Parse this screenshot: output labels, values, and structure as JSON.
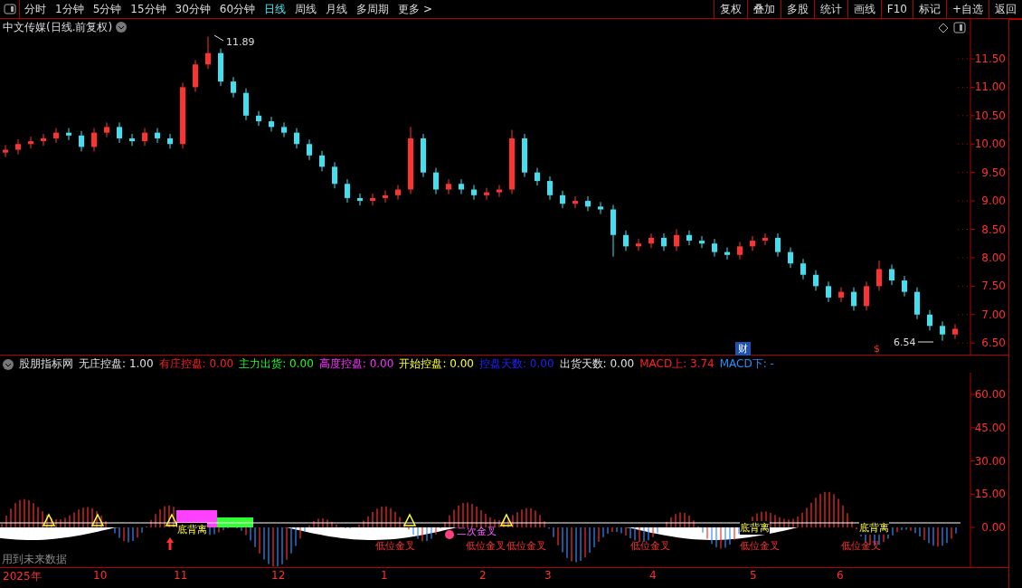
{
  "toolbar": {
    "periods": [
      {
        "label": "分时",
        "selected": false
      },
      {
        "label": "1分钟",
        "selected": false
      },
      {
        "label": "5分钟",
        "selected": false
      },
      {
        "label": "15分钟",
        "selected": false
      },
      {
        "label": "30分钟",
        "selected": false
      },
      {
        "label": "60分钟",
        "selected": false
      },
      {
        "label": "日线",
        "selected": true
      },
      {
        "label": "周线",
        "selected": false
      },
      {
        "label": "月线",
        "selected": false
      },
      {
        "label": "多周期",
        "selected": false
      },
      {
        "label": "更多 >",
        "selected": false
      }
    ],
    "buttons": [
      "复权",
      "叠加",
      "多股",
      "统计",
      "画线",
      "F10",
      "标记",
      "+自选",
      "返回"
    ]
  },
  "price_panel": {
    "title": "中文传媒(日线.前复权)",
    "high_label": "11.89",
    "low_label": "6.54",
    "finance_badge": "财",
    "dividend_mark": "$",
    "chart_data": {
      "type": "candlestick",
      "ylim": [
        6.28,
        12.2
      ],
      "yticks": [
        {
          "value": 11.5,
          "label": "11.50"
        },
        {
          "value": 11,
          "label": "11.00"
        },
        {
          "value": 10.5,
          "label": "10.50"
        },
        {
          "value": 10,
          "label": "10.00"
        },
        {
          "value": 9.5,
          "label": "9.50"
        },
        {
          "value": 9,
          "label": "9.00"
        },
        {
          "value": 8.5,
          "label": "8.50"
        },
        {
          "value": 8,
          "label": "8.00"
        },
        {
          "value": 7.5,
          "label": "7.50"
        },
        {
          "value": 7,
          "label": "7.00"
        },
        {
          "value": 6.5,
          "label": "6.50"
        }
      ],
      "categories": [
        null,
        null,
        null,
        null,
        null,
        null,
        null,
        null,
        null,
        null,
        null,
        null,
        null,
        null,
        null,
        null,
        null,
        null,
        null,
        null,
        null,
        null,
        null,
        null,
        null,
        null,
        null,
        null,
        null,
        null,
        null,
        null,
        null,
        null,
        null,
        null,
        null,
        null,
        null,
        null,
        null,
        null,
        null,
        null,
        null,
        null,
        null,
        null,
        null,
        null,
        null,
        null,
        null,
        null,
        null,
        null,
        null,
        null,
        null,
        null,
        null,
        null,
        null,
        null,
        null,
        null,
        null,
        null,
        null,
        null,
        null,
        null,
        null,
        null,
        null,
        null
      ],
      "ohlc": [
        [
          9.85,
          9.98,
          9.77,
          9.9
        ],
        [
          9.9,
          10.08,
          9.82,
          10.0
        ],
        [
          10.0,
          10.13,
          9.92,
          10.05
        ],
        [
          10.05,
          10.18,
          9.97,
          10.1
        ],
        [
          10.1,
          10.28,
          10.02,
          10.2
        ],
        [
          10.2,
          10.28,
          10.07,
          10.15
        ],
        [
          10.15,
          10.23,
          9.87,
          9.95
        ],
        [
          9.95,
          10.28,
          9.87,
          10.2
        ],
        [
          10.2,
          10.38,
          10.12,
          10.3
        ],
        [
          10.3,
          10.38,
          10.02,
          10.1
        ],
        [
          10.1,
          10.18,
          9.97,
          10.05
        ],
        [
          10.05,
          10.28,
          9.97,
          10.2
        ],
        [
          10.2,
          10.28,
          10.02,
          10.1
        ],
        [
          10.1,
          10.18,
          9.92,
          10.0
        ],
        [
          10.0,
          11.08,
          9.92,
          11.0
        ],
        [
          11.0,
          11.48,
          10.92,
          11.4
        ],
        [
          11.4,
          11.89,
          11.32,
          11.6
        ],
        [
          11.6,
          11.68,
          11.02,
          11.1
        ],
        [
          11.1,
          11.18,
          10.82,
          10.9
        ],
        [
          10.9,
          10.98,
          10.42,
          10.5
        ],
        [
          10.5,
          10.58,
          10.32,
          10.4
        ],
        [
          10.4,
          10.48,
          10.22,
          10.3
        ],
        [
          10.3,
          10.38,
          10.12,
          10.2
        ],
        [
          10.2,
          10.28,
          9.92,
          10.0
        ],
        [
          10.0,
          10.08,
          9.72,
          9.8
        ],
        [
          9.8,
          9.88,
          9.52,
          9.6
        ],
        [
          9.6,
          9.68,
          9.22,
          9.3
        ],
        [
          9.3,
          9.38,
          8.97,
          9.05
        ],
        [
          9.05,
          9.13,
          8.92,
          9.0
        ],
        [
          9.0,
          9.13,
          8.92,
          9.05
        ],
        [
          9.05,
          9.18,
          8.97,
          9.1
        ],
        [
          9.1,
          9.28,
          9.02,
          9.2
        ],
        [
          9.2,
          10.3,
          9.12,
          10.1
        ],
        [
          10.1,
          10.18,
          9.42,
          9.5
        ],
        [
          9.5,
          9.58,
          9.12,
          9.2
        ],
        [
          9.2,
          9.38,
          9.12,
          9.3
        ],
        [
          9.3,
          9.38,
          9.12,
          9.2
        ],
        [
          9.2,
          9.28,
          9.02,
          9.1
        ],
        [
          9.1,
          9.23,
          9.02,
          9.15
        ],
        [
          9.15,
          9.28,
          9.07,
          9.2
        ],
        [
          9.2,
          10.25,
          9.12,
          10.1
        ],
        [
          10.1,
          10.18,
          9.42,
          9.5
        ],
        [
          9.5,
          9.58,
          9.27,
          9.35
        ],
        [
          9.35,
          9.43,
          9.02,
          9.1
        ],
        [
          9.1,
          9.18,
          8.87,
          8.95
        ],
        [
          8.95,
          9.08,
          8.87,
          9.0
        ],
        [
          9.0,
          9.08,
          8.82,
          8.9
        ],
        [
          8.9,
          8.98,
          8.77,
          8.85
        ],
        [
          8.85,
          8.93,
          8.02,
          8.4
        ],
        [
          8.4,
          8.48,
          8.12,
          8.2
        ],
        [
          8.2,
          8.33,
          8.12,
          8.25
        ],
        [
          8.25,
          8.43,
          8.17,
          8.35
        ],
        [
          8.35,
          8.43,
          8.12,
          8.2
        ],
        [
          8.2,
          8.5,
          8.12,
          8.4
        ],
        [
          8.4,
          8.48,
          8.22,
          8.3
        ],
        [
          8.3,
          8.38,
          8.17,
          8.25
        ],
        [
          8.25,
          8.33,
          8.02,
          8.1
        ],
        [
          8.1,
          8.18,
          7.97,
          8.05
        ],
        [
          8.05,
          8.28,
          7.97,
          8.2
        ],
        [
          8.2,
          8.38,
          8.12,
          8.3
        ],
        [
          8.3,
          8.43,
          8.22,
          8.35
        ],
        [
          8.35,
          8.43,
          8.02,
          8.1
        ],
        [
          8.1,
          8.18,
          7.82,
          7.9
        ],
        [
          7.9,
          7.98,
          7.62,
          7.7
        ],
        [
          7.7,
          7.78,
          7.42,
          7.5
        ],
        [
          7.5,
          7.58,
          7.22,
          7.3
        ],
        [
          7.3,
          7.48,
          7.22,
          7.4
        ],
        [
          7.4,
          7.48,
          7.07,
          7.15
        ],
        [
          7.15,
          7.58,
          7.07,
          7.5
        ],
        [
          7.5,
          7.95,
          7.42,
          7.8
        ],
        [
          7.8,
          7.88,
          7.52,
          7.6
        ],
        [
          7.6,
          7.68,
          7.32,
          7.4
        ],
        [
          7.4,
          7.48,
          6.92,
          7.0
        ],
        [
          7.0,
          7.08,
          6.72,
          6.8
        ],
        [
          6.8,
          6.88,
          6.54,
          6.65
        ],
        [
          6.65,
          6.83,
          6.57,
          6.75
        ]
      ]
    }
  },
  "indicator": {
    "name": "股朋指标网",
    "items": [
      {
        "label": "无庄控盘:",
        "value": "1.00",
        "color": "#e0e0e0"
      },
      {
        "label": "有庄控盘:",
        "value": "0.00",
        "color": "#ff2020"
      },
      {
        "label": "主力出货:",
        "value": "0.00",
        "color": "#20ff20"
      },
      {
        "label": "高度控盘:",
        "value": "0.00",
        "color": "#ff30ff"
      },
      {
        "label": "开始控盘:",
        "value": "0.00",
        "color": "#ffff30"
      },
      {
        "label": "控盘天数:",
        "value": "0.00",
        "color": "#2020ff"
      },
      {
        "label": "出货天数:",
        "value": "0.00",
        "color": "#e0e0e0"
      },
      {
        "label": "MACD上:",
        "value": "3.74",
        "color": "#ff2020"
      },
      {
        "label": "MACD下:",
        "value": "-",
        "color": "#2090ff"
      }
    ],
    "yticks": [
      "60.00",
      "45.00",
      "30.00",
      "15.00",
      "0.00"
    ],
    "signals": [
      {
        "text": "底背离",
        "kind": "divergence"
      },
      {
        "text": "二次金叉",
        "kind": "second"
      },
      {
        "text": "底背离",
        "kind": "divergence"
      },
      {
        "text": "底背离",
        "kind": "divergence"
      },
      {
        "text": "低位金叉",
        "kind": "cross"
      },
      {
        "text": "低位金叉",
        "kind": "cross"
      },
      {
        "text": "低位金叉",
        "kind": "cross"
      },
      {
        "text": "低位金叉",
        "kind": "cross"
      },
      {
        "text": "低位金叉",
        "kind": "cross"
      },
      {
        "text": "低位金叉",
        "kind": "cross"
      }
    ],
    "note": "用到未来数据"
  },
  "date_axis": [
    "2025年",
    "10",
    "11",
    "12",
    "1",
    "2",
    "3",
    "4",
    "5",
    "6"
  ]
}
